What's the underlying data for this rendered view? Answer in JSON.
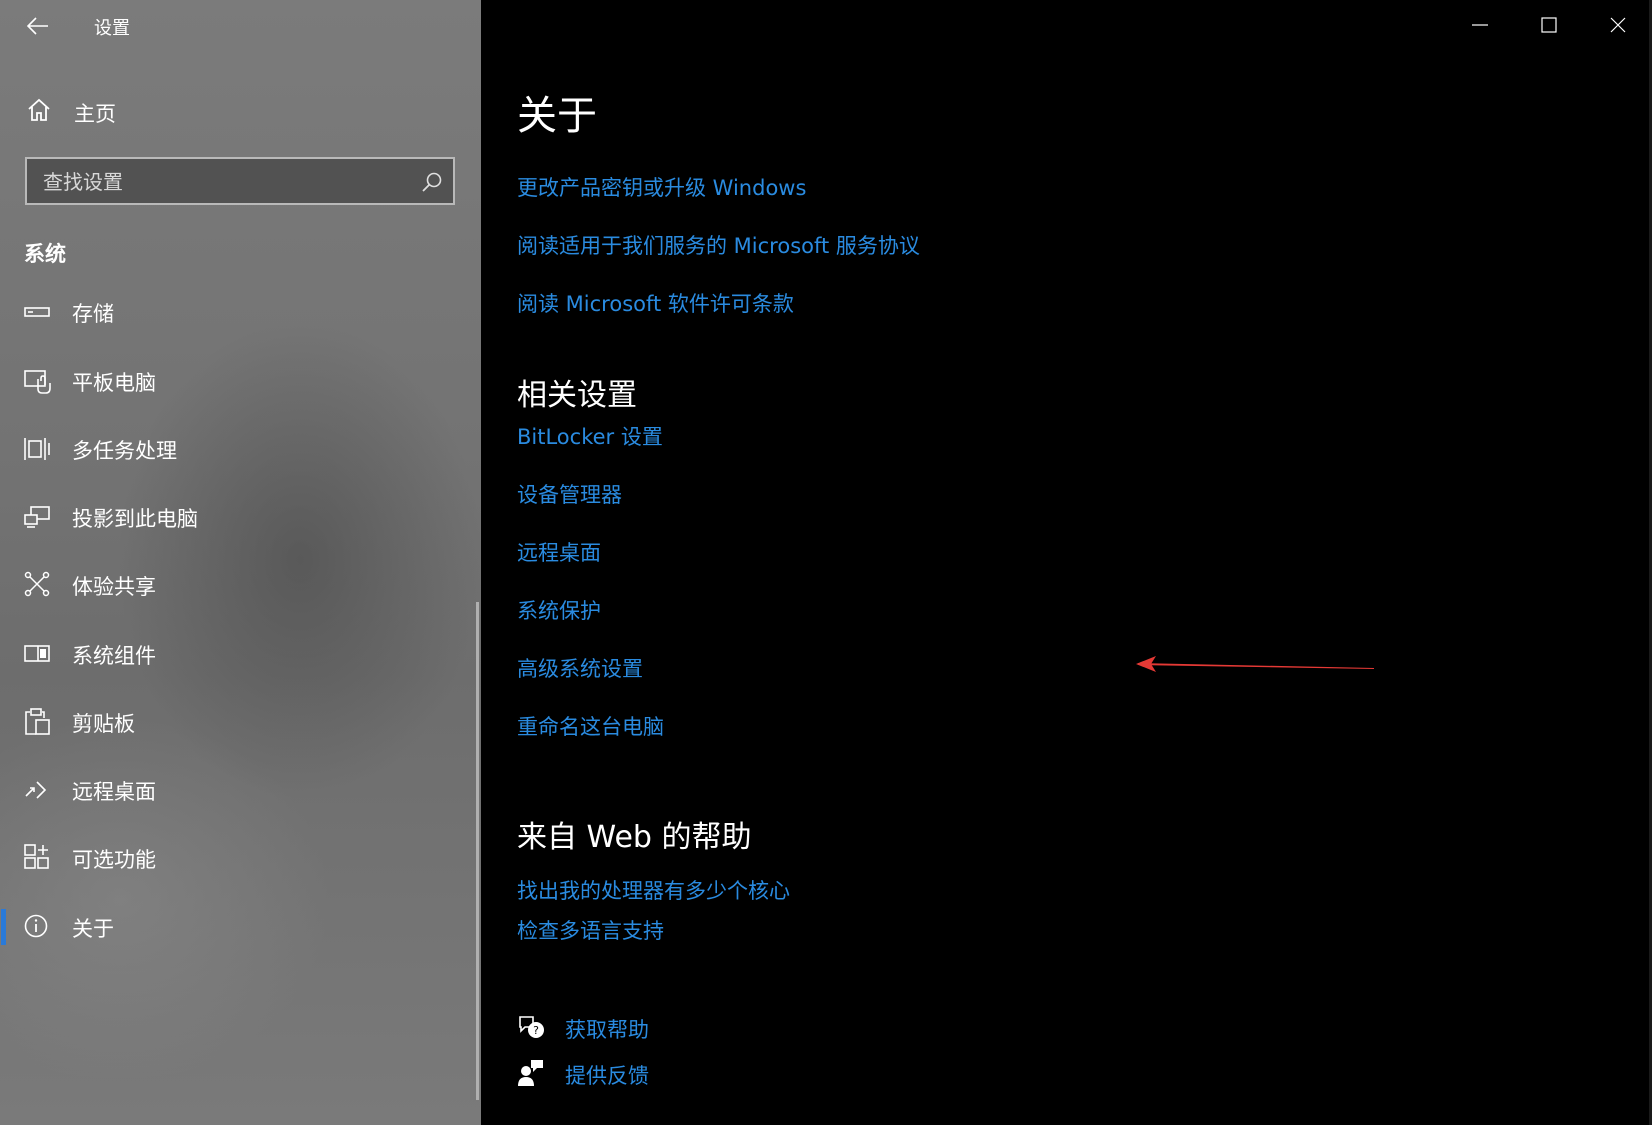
{
  "window": {
    "title": "设置"
  },
  "sidebar": {
    "home_label": "主页",
    "search": {
      "placeholder": "查找设置"
    },
    "section": "系统",
    "items": [
      {
        "label": "存储",
        "icon": "storage-icon"
      },
      {
        "label": "平板电脑",
        "icon": "tablet-icon"
      },
      {
        "label": "多任务处理",
        "icon": "multitasking-icon"
      },
      {
        "label": "投影到此电脑",
        "icon": "projecting-icon"
      },
      {
        "label": "体验共享",
        "icon": "shared-experiences-icon"
      },
      {
        "label": "系统组件",
        "icon": "system-components-icon"
      },
      {
        "label": "剪贴板",
        "icon": "clipboard-icon"
      },
      {
        "label": "远程桌面",
        "icon": "remote-desktop-icon"
      },
      {
        "label": "可选功能",
        "icon": "optional-features-icon"
      },
      {
        "label": "关于",
        "icon": "info-icon",
        "selected": true
      }
    ]
  },
  "main": {
    "title": "关于",
    "top_links": [
      "更改产品密钥或升级 Windows",
      "阅读适用于我们服务的 Microsoft 服务协议",
      "阅读 Microsoft 软件许可条款"
    ],
    "related": {
      "title": "相关设置",
      "links": [
        "BitLocker 设置",
        "设备管理器",
        "远程桌面",
        "系统保护",
        "高级系统设置",
        "重命名这台电脑"
      ]
    },
    "web_help": {
      "title": "来自 Web 的帮助",
      "links": [
        "找出我的处理器有多少个核心",
        "检查多语言支持"
      ]
    },
    "support": {
      "get_help": "获取帮助",
      "feedback": "提供反馈"
    }
  },
  "colors": {
    "link": "#2a8be0",
    "accent": "#2a7ad8",
    "annotation": "#e53935"
  }
}
